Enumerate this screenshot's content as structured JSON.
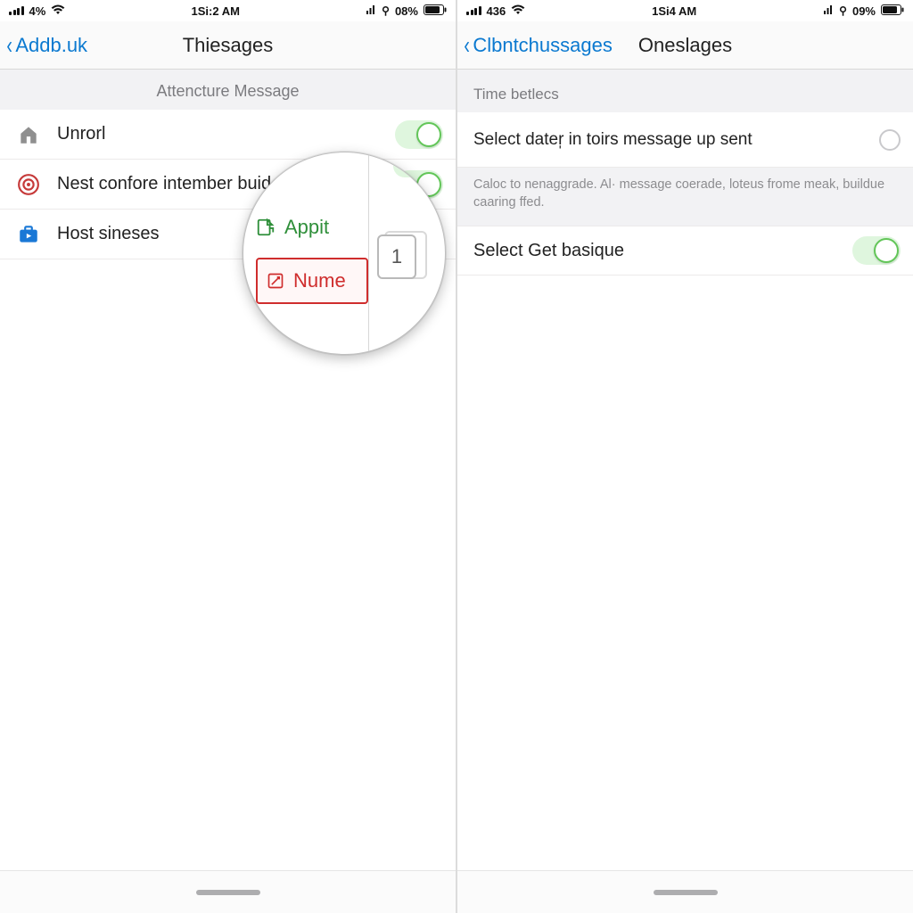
{
  "left": {
    "status": {
      "signal_pct": "4%",
      "time": "1Si:2 AM",
      "battery": "08%"
    },
    "nav": {
      "back": "Addb.uk",
      "title": "Thiesages"
    },
    "section_header": "Attencture Message",
    "rows": [
      {
        "icon": "home-icon",
        "label": "Unrorl",
        "toggle": true
      },
      {
        "icon": "target-icon",
        "label": "Nest confore intember buid",
        "toggle": true
      },
      {
        "icon": "briefcase-icon",
        "label": "Host sineses",
        "toggle": null
      }
    ],
    "loupe": {
      "item_a": "Appit",
      "item_b": "Nume",
      "card": "1"
    }
  },
  "right": {
    "status": {
      "signal_pct": "436",
      "time": "1Si4 AM",
      "battery": "09%"
    },
    "nav": {
      "back": "Clbntchussages",
      "title": "Oneslages"
    },
    "section_header": "Time betlecs",
    "row1_label": "Select dater̩ in toirs message up sent",
    "footer_note": "Caloc to nenaggrade. Al· message coerade, loteus frome meak, buildue caaring ffed.",
    "row2_label": "Select Get basique",
    "row2_toggle": true
  },
  "colors": {
    "accent_blue": "#0b79d0",
    "toggle_green": "#62c658",
    "danger_red": "#cf2d2d"
  }
}
